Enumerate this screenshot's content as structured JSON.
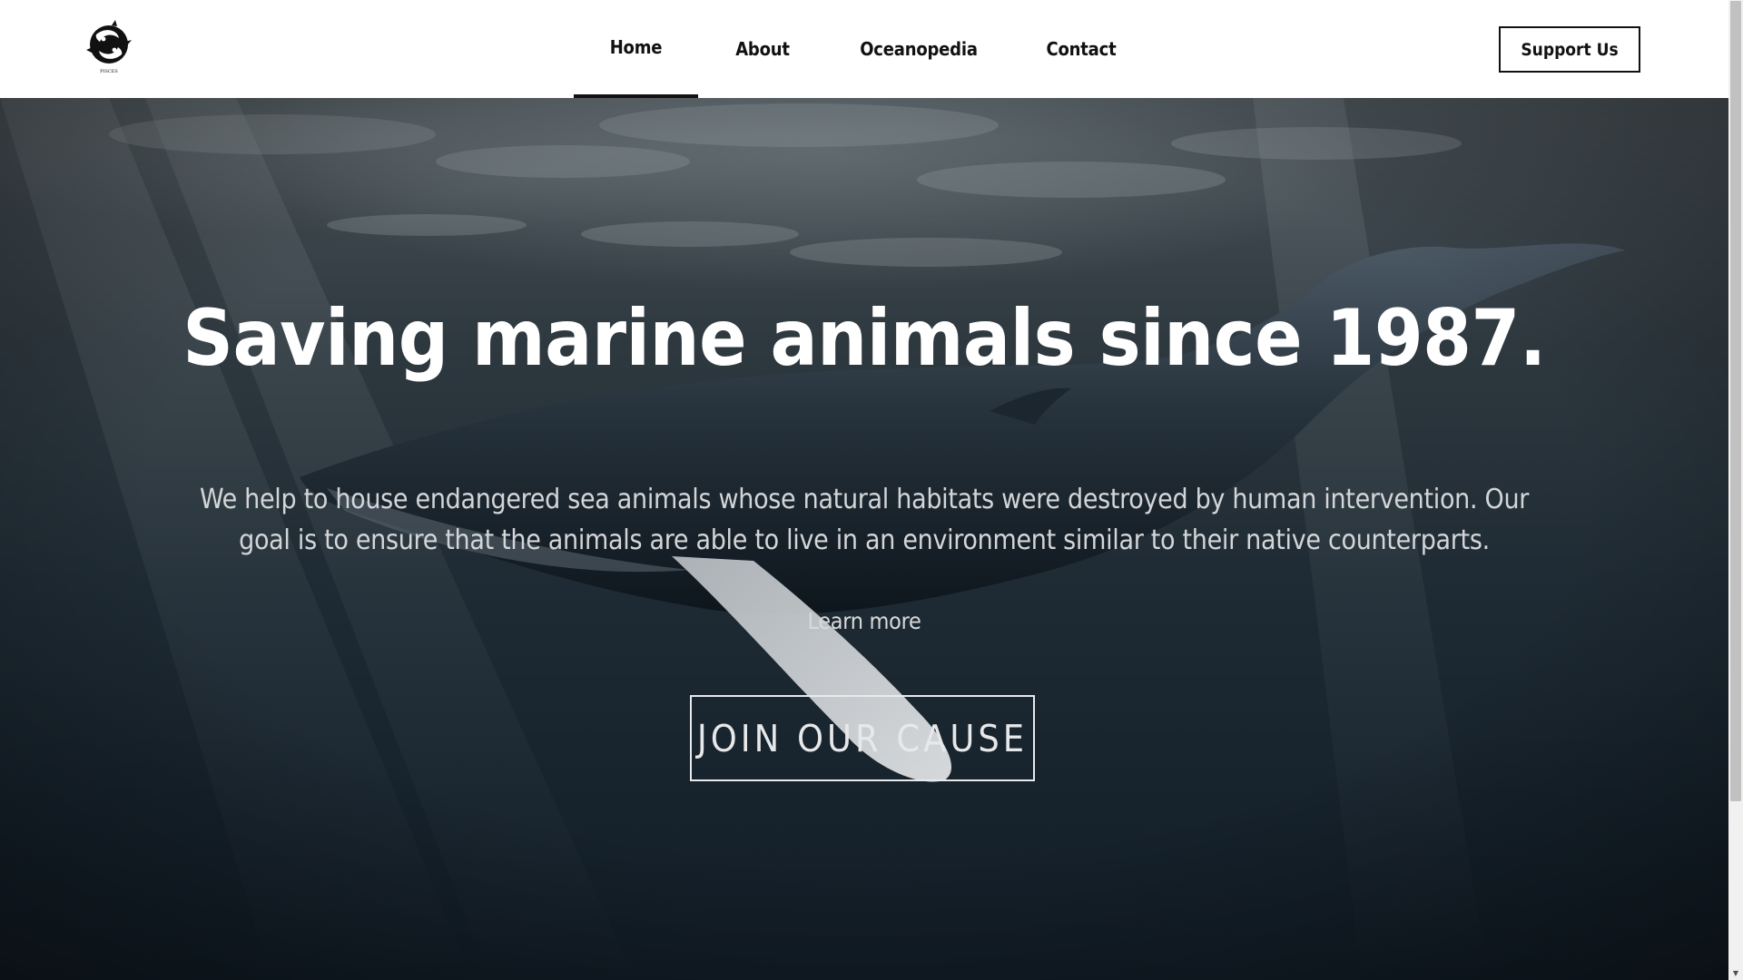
{
  "header": {
    "logo_icon": "pisces-fish-logo-icon",
    "logo_text": "PISCES",
    "nav": [
      {
        "label": "Home",
        "active": true
      },
      {
        "label": "About",
        "active": false
      },
      {
        "label": "Oceanopedia",
        "active": false
      },
      {
        "label": "Contact",
        "active": false
      }
    ],
    "support_label": "Support Us"
  },
  "hero": {
    "title": "Saving marine animals since 1987.",
    "description": "We help to house endangered sea animals whose natural habitats were destroyed by human intervention. Our goal is to ensure that the animals are able to live in an environment similar to their native counterparts.",
    "learn_more": "Learn more",
    "cta": "JOIN OUR CAUSE",
    "background_image": "underwater-humpback-whale"
  },
  "colors": {
    "header_bg": "#ffffff",
    "text_dark": "#111111",
    "hero_text": "#ffffff",
    "hero_subtext": "#d3d6d8",
    "water_deep": "#121d27"
  }
}
